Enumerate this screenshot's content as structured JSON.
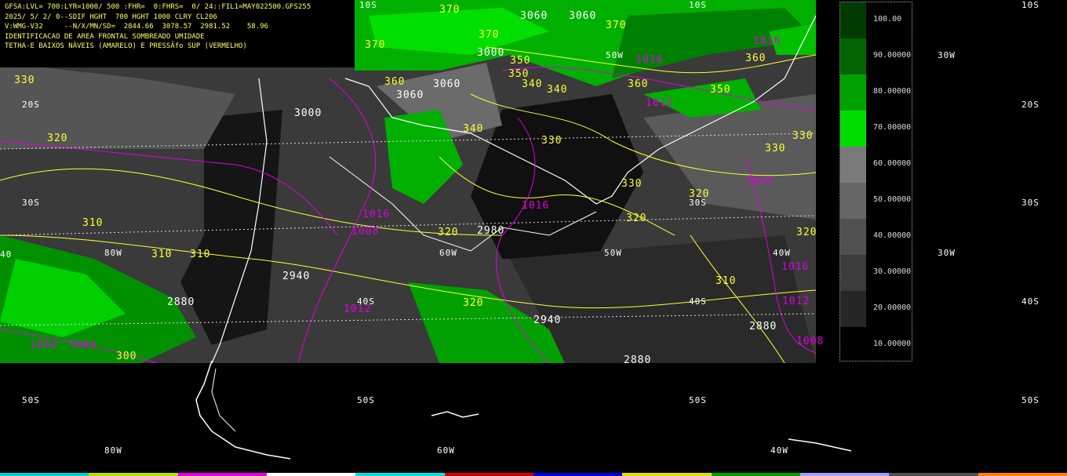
{
  "header": {
    "lines": [
      "GFSA:LVL= 700:LYR=1000/ 500 :FHR=  0:FHRS=  0/ 24::FIL1=MAY022500.GFS255",
      "2025/ 5/ 2/ 0--SDIF HGHT  700 HGHT 1000 CLRY CL206",
      "V:WMG-V32     --N/X/MN/SD=  2844.66  3078.57  2981.52    58.96",
      "IDENTIFICACAO DE AREA FRONTAL SOMBREADO UMIDADE",
      "TETHA-E BAIXOS NÂVEIS (AMARELO) E PRESSÃfo SUP (VERMELHO)"
    ]
  },
  "legend": {
    "levels": [
      "100.00",
      "90.00000",
      "80.00000",
      "70.00000",
      "60.00000",
      "50.00000",
      "40.00000",
      "30.00000",
      "20.00000",
      "10.00000"
    ],
    "colors": [
      "#003a00",
      "#006400",
      "#00a000",
      "#00dd00",
      "#7a7a7a",
      "#666666",
      "#505050",
      "#3c3c3c",
      "#262626"
    ]
  },
  "lat_labels": [
    "10S",
    "20S",
    "30S",
    "40S",
    "50S"
  ],
  "lon_labels": [
    "80W",
    "60W",
    "50W",
    "40W",
    "30W"
  ],
  "theta_e_labels": [
    "370",
    "370",
    "370",
    "360",
    "350",
    "350",
    "340",
    "340",
    "330",
    "330",
    "330",
    "320",
    "320",
    "320",
    "320",
    "310",
    "310",
    "310",
    "300",
    "330",
    "320",
    "360",
    "360",
    "370",
    "350",
    "340",
    "320",
    "310",
    "330"
  ],
  "pressure_labels": [
    "1016",
    "1016",
    "1012",
    "1008",
    "1020",
    "1016",
    "1012",
    "1016",
    "1008",
    "1004",
    "1004",
    "1016",
    "1012"
  ],
  "height_labels": [
    "3060",
    "3060",
    "3000",
    "2980",
    "2940",
    "2880",
    "2940",
    "2880",
    "2880",
    "3060",
    "3060",
    "3000"
  ],
  "bottom_colors": [
    "#00d0d0",
    "#b0e000",
    "#e000e0",
    "#ffffff",
    "#00e0e0",
    "#d00000",
    "#0000e0",
    "#e0e000",
    "#00a000",
    "#a0a0ff",
    "#505050",
    "#ff8000"
  ]
}
